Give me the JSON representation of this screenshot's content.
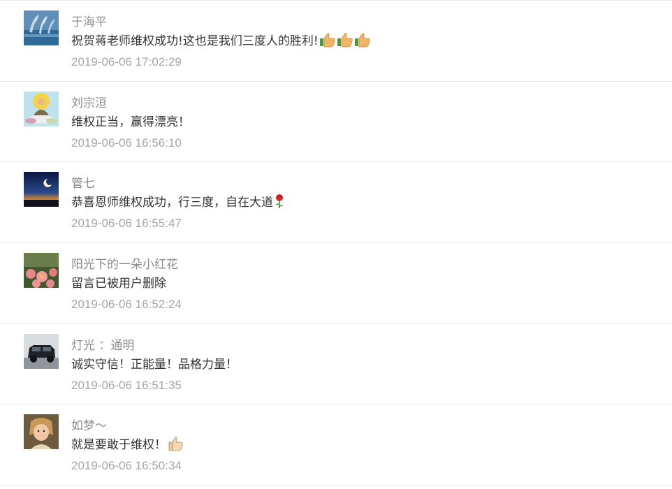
{
  "comments": [
    {
      "name": "于海平",
      "text": "祝贺蒋老师维权成功!这也是我们三度人的胜利!",
      "time": "2019-06-06 17:02:29",
      "emojis": [
        "thumbs-up-icon",
        "thumbs-up-icon",
        "thumbs-up-icon"
      ],
      "avatar": "dolphins-avatar"
    },
    {
      "name": "刘宗洹",
      "text": "维权正当，赢得漂亮！",
      "time": "2019-06-06 16:56:10",
      "emojis": [],
      "avatar": "buddha-avatar"
    },
    {
      "name": "管七",
      "text": "恭喜恩师维权成功，行三度，自在大道",
      "time": "2019-06-06 16:55:47",
      "emojis": [
        "rose-icon"
      ],
      "avatar": "night-sky-avatar"
    },
    {
      "name": "阳光下的一朵小红花",
      "text": "留言已被用户删除",
      "time": "2019-06-06 16:52:24",
      "emojis": [],
      "avatar": "flowers-avatar"
    },
    {
      "name": "灯光 ：通明",
      "text": "诚实守信！正能量！品格力量！",
      "time": "2019-06-06 16:51:35",
      "emojis": [],
      "avatar": "car-avatar"
    },
    {
      "name": "如梦～",
      "text": "就是要敢于维权！",
      "time": "2019-06-06 16:50:34",
      "emojis": [
        "thumbs-up-icon"
      ],
      "avatar": "child-avatar"
    }
  ],
  "colors": {
    "name": "#8c8c8c",
    "text": "#333333",
    "time": "#a6a6a6",
    "divider": "#e7e7e7"
  }
}
